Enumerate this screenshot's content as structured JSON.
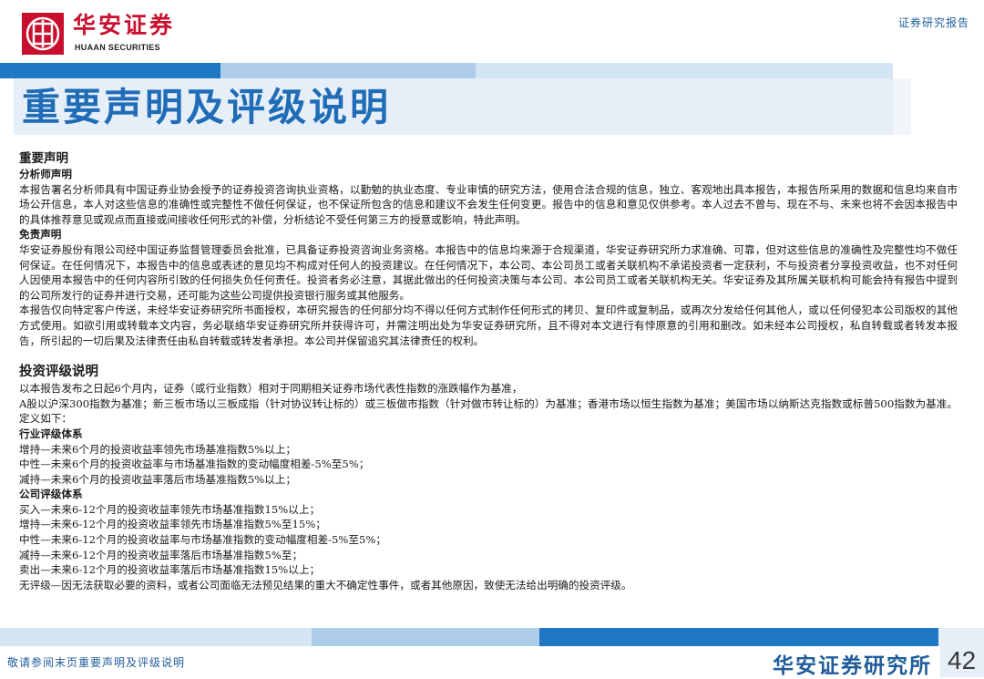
{
  "header": {
    "logo_cn": "华安证券",
    "logo_en": "HUAAN SECURITIES",
    "report_type": "证券研究报告"
  },
  "title": "重要声明及评级说明",
  "disclaimer": {
    "heading": "重要声明",
    "analyst_heading": "分析师声明",
    "analyst_text": "本报告署名分析师具有中国证券业协会授予的证券投资咨询执业资格，以勤勉的执业态度、专业审慎的研究方法，使用合法合规的信息，独立、客观地出具本报告，本报告所采用的数据和信息均来自市场公开信息，本人对这些信息的准确性或完整性不做任何保证，也不保证所包含的信息和建议不会发生任何变更。报告中的信息和意见仅供参考。本人过去不曾与、现在不与、未来也将不会因本报告中的具体推荐意见或观点而直接或间接收任何形式的补偿，分析结论不受任何第三方的授意或影响，特此声明。",
    "exemption_heading": "免责声明",
    "exemption_text_1": "华安证券股份有限公司经中国证券监督管理委员会批准，已具备证券投资咨询业务资格。本报告中的信息均来源于合规渠道，华安证券研究所力求准确、可靠，但对这些信息的准确性及完整性均不做任何保证。在任何情况下，本报告中的信息或表述的意见均不构成对任何人的投资建议。在任何情况下，本公司、本公司员工或者关联机构不承诺投资者一定获利，不与投资者分享投资收益，也不对任何人因使用本报告中的任何内容所引致的任何损失负任何责任。投资者务必注意，其据此做出的任何投资决策与本公司、本公司员工或者关联机构无关。华安证券及其所属关联机构可能会持有报告中提到的公司所发行的证券并进行交易，还可能为这些公司提供投资银行服务或其他服务。",
    "exemption_text_2": "本报告仅向特定客户传送，未经华安证券研究所书面授权，本研究报告的任何部分均不得以任何方式制作任何形式的拷贝、复印件或复制品，或再次分发给任何其他人，或以任何侵犯本公司版权的其他方式使用。如欲引用或转载本文内容，务必联络华安证券研究所并获得许可，并需注明出处为华安证券研究所，且不得对本文进行有悖原意的引用和删改。如未经本公司授权，私自转载或者转发本报告，所引起的一切后果及法律责任由私自转载或转发者承担。本公司并保留追究其法律责任的权利。"
  },
  "rating": {
    "heading": "投资评级说明",
    "intro_1": "以本报告发布之日起6个月内，证券（或行业指数）相对于同期相关证券市场代表性指数的涨跌幅作为基准，",
    "intro_2": "A股以沪深300指数为基准；新三板市场以三板成指（针对协议转让标的）或三板做市指数（针对做市转让标的）为基准；香港市场以恒生指数为基准；美国市场以纳斯达克指数或标普500指数为基准。定义如下：",
    "industry_heading": "行业评级体系",
    "industry_items": [
      "增持—未来6个月的投资收益率领先市场基准指数5%以上；",
      "中性—未来6个月的投资收益率与市场基准指数的变动幅度相差-5%至5%；",
      "减持—未来6个月的投资收益率落后市场基准指数5%以上；"
    ],
    "company_heading": "公司评级体系",
    "company_items": [
      "买入—未来6-12个月的投资收益率领先市场基准指数15%以上；",
      "增持—未来6-12个月的投资收益率领先市场基准指数5%至15%；",
      "中性—未来6-12个月的投资收益率与市场基准指数的变动幅度相差-5%至5%；",
      "减持—未来6-12个月的投资收益率落后市场基准指数5%至；",
      "卖出—未来6-12个月的投资收益率落后市场基准指数15%以上；",
      "无评级—因无法获取必要的资料，或者公司面临无法预见结果的重大不确定性事件，或者其他原因，致使无法给出明确的投资评级。"
    ]
  },
  "footer": {
    "note": "敬请参阅末页重要声明及评级说明",
    "brand": "华安证券研究所",
    "page_number": "42"
  },
  "colors": {
    "brand_red": "#c8102e",
    "brand_blue": "#1f78c4",
    "light_blue": "#aecde9",
    "pale_blue": "#d4e5f4",
    "title_blue": "#1f6cb7"
  }
}
